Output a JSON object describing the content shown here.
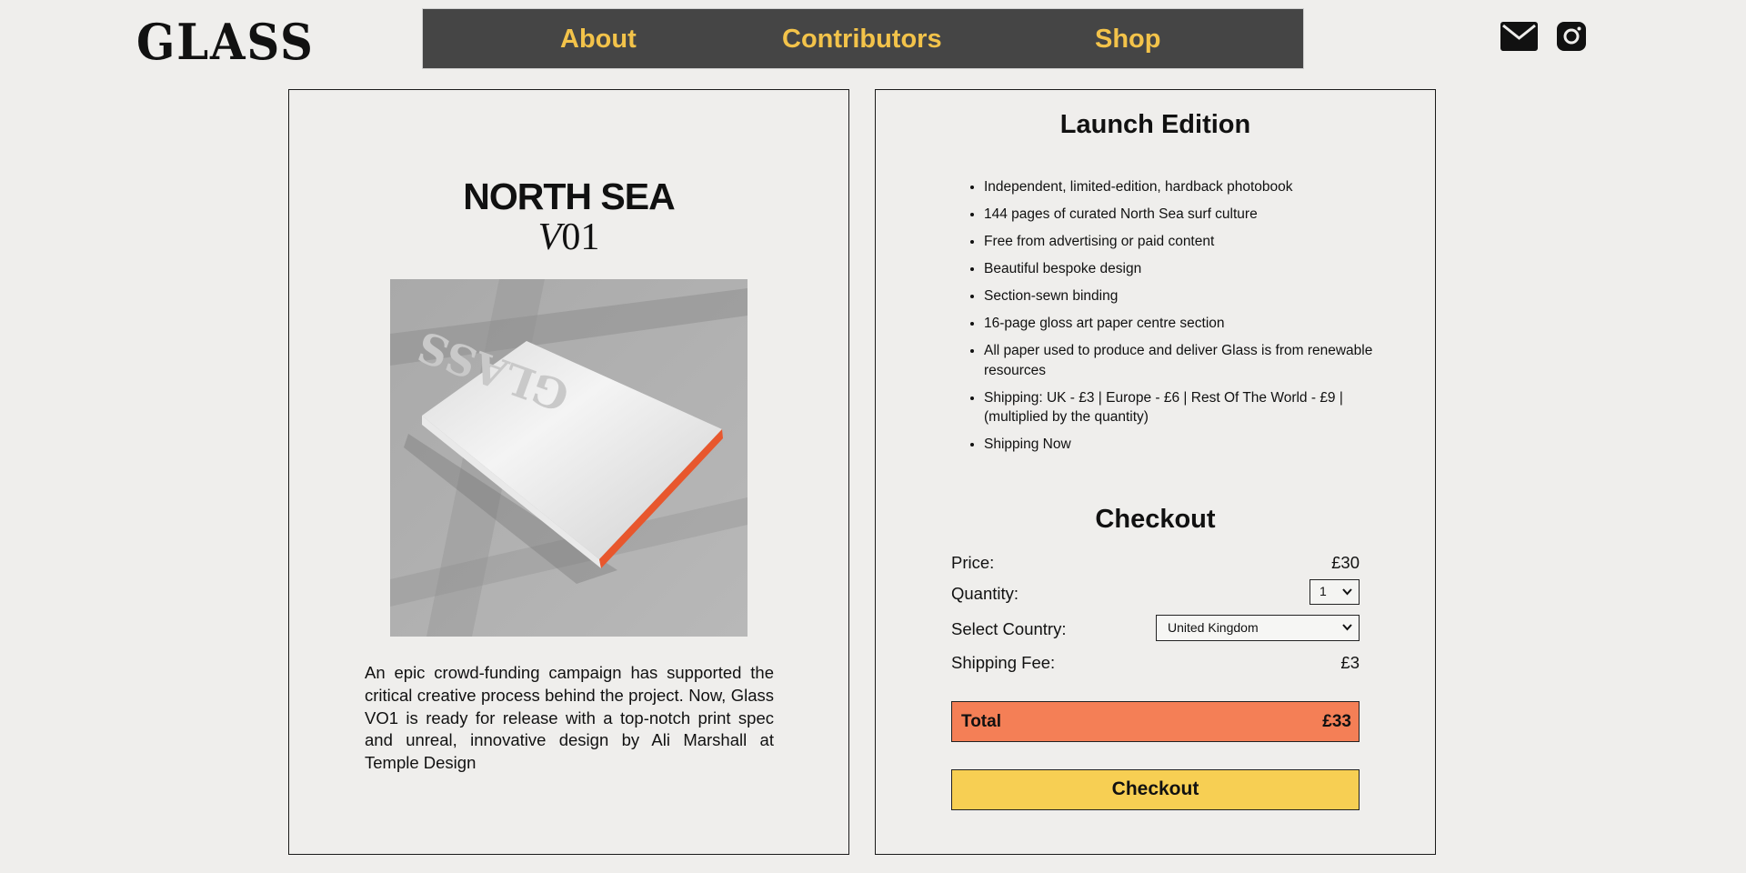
{
  "brand": {
    "logo_text": "GLASS"
  },
  "nav": {
    "items": [
      {
        "label": "About"
      },
      {
        "label": "Contributors"
      },
      {
        "label": "Shop"
      }
    ]
  },
  "social": {
    "icons": [
      "mail-icon",
      "instagram-icon"
    ]
  },
  "product": {
    "title": "NORTH SEA",
    "edition_prefix": "V",
    "edition_number": "01",
    "image_icon": "book-photo",
    "description": "An epic crowd-funding campaign has supported the critical creative process behind the project. Now, Glass VO1 is ready for release with a top-notch print spec and unreal, innovative design by Ali Marshall at Temple Design"
  },
  "launch": {
    "title": "Launch Edition",
    "features": [
      "Independent, limited-edition, hardback photobook",
      "144 pages of curated North Sea surf culture",
      "Free from advertising or paid content",
      "Beautiful bespoke design",
      "Section-sewn binding",
      "16-page gloss art paper centre section",
      "All paper used to produce and deliver Glass is from renewable resources",
      "Shipping: UK - £3 | Europe - £6 | Rest Of The World - £9 | (multiplied by the quantity)",
      "Shipping Now"
    ]
  },
  "checkout": {
    "title": "Checkout",
    "price_label": "Price:",
    "price_value": "£30",
    "quantity_label": "Quantity:",
    "quantity_value": "1",
    "country_label": "Select Country:",
    "country_value": "United Kingdom",
    "shipping_label": "Shipping Fee:",
    "shipping_value": "£3",
    "total_label": "Total",
    "total_value": "£33",
    "button_label": "Checkout"
  },
  "colors": {
    "background": "#efeeec",
    "nav_bg": "#454545",
    "nav_text": "#f3c34a",
    "total_bg": "#f47f56",
    "button_bg": "#f7cf53"
  }
}
